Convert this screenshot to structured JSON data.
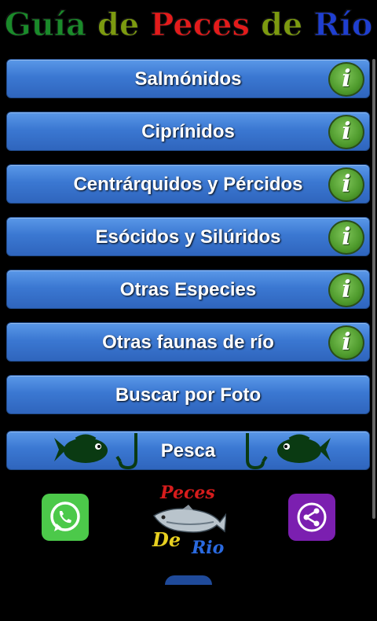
{
  "header": {
    "title_parts": [
      "Guía",
      "de",
      "Peces",
      "de",
      "Río"
    ]
  },
  "menu": {
    "items": [
      {
        "label": "Salmónidos",
        "info_icon": "info-icon"
      },
      {
        "label": "Ciprínidos",
        "info_icon": "info-icon"
      },
      {
        "label": "Centrárquidos y Pércidos",
        "info_icon": "info-icon"
      },
      {
        "label": "Esócidos y Silúridos",
        "info_icon": "info-icon"
      },
      {
        "label": "Otras Especies",
        "info_icon": "info-icon"
      },
      {
        "label": "Otras faunas de río",
        "info_icon": "info-icon"
      }
    ],
    "photo_search_label": "Buscar por Foto",
    "fishing_label": "Pesca",
    "info_glyph": "i"
  },
  "footer": {
    "whatsapp_icon": "whatsapp-icon",
    "share_icon": "share-icon",
    "logo": {
      "line1": "Peces",
      "line2": "De",
      "line3": "Rio"
    }
  },
  "colors": {
    "button": "#3b78d2",
    "info": "#4e9a2c",
    "whatsapp": "#4cc94a",
    "share": "#7b1fb0"
  }
}
